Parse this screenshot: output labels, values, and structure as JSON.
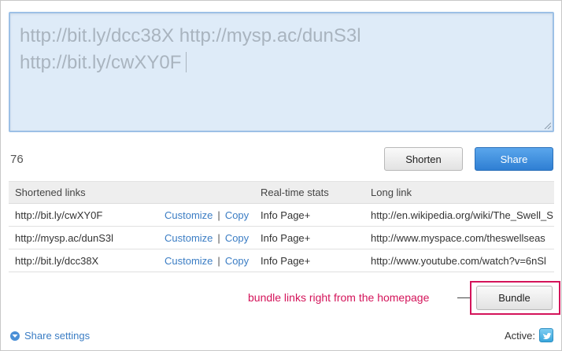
{
  "compose": {
    "line1": "http://bit.ly/dcc38X http://mysp.ac/dunS3l",
    "line2": "http://bit.ly/cwXY0F"
  },
  "char_count": "76",
  "buttons": {
    "shorten": "Shorten",
    "share": "Share",
    "bundle": "Bundle"
  },
  "table": {
    "headers": {
      "short": "Shortened links",
      "stats": "Real-time stats",
      "long": "Long link"
    },
    "rows": [
      {
        "short": "http://bit.ly/cwXY0F",
        "customize": "Customize",
        "copy": "Copy",
        "stats": "Info Page+",
        "long": "http://en.wikipedia.org/wiki/The_Swell_S"
      },
      {
        "short": "http://mysp.ac/dunS3l",
        "customize": "Customize",
        "copy": "Copy",
        "stats": "Info Page+",
        "long": "http://www.myspace.com/theswellseas"
      },
      {
        "short": "http://bit.ly/dcc38X",
        "customize": "Customize",
        "copy": "Copy",
        "stats": "Info Page+",
        "long": "http://www.youtube.com/watch?v=6nSl"
      }
    ],
    "separator": "|"
  },
  "annotation": "bundle links right from the homepage",
  "footer": {
    "share_settings": "Share settings",
    "active_label": "Active:"
  },
  "icons": {
    "settings": "chevron-down-circle-icon",
    "twitter": "twitter-bird-icon"
  },
  "colors": {
    "accent_blue": "#3b7dc4",
    "share_button": "#2f7fd3",
    "annotation": "#d4145a",
    "compose_bg": "#deebf8"
  }
}
